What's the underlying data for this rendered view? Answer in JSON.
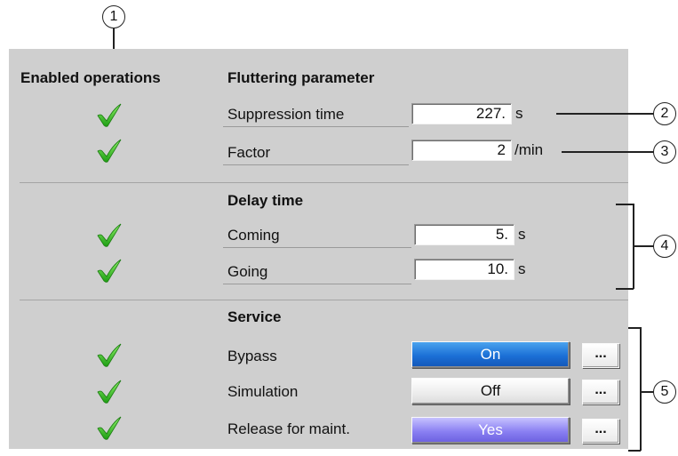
{
  "headers": {
    "enabled_operations": "Enabled operations",
    "fluttering_parameter": "Fluttering parameter",
    "delay_time": "Delay time",
    "service": "Service"
  },
  "fluttering": {
    "suppression_time": {
      "label": "Suppression time",
      "value": "227.",
      "unit": "s"
    },
    "factor": {
      "label": "Factor",
      "value": "2",
      "unit": "/min"
    }
  },
  "delay": {
    "coming": {
      "label": "Coming",
      "value": "5.",
      "unit": "s"
    },
    "going": {
      "label": "Going",
      "value": "10.",
      "unit": "s"
    }
  },
  "service": {
    "bypass": {
      "label": "Bypass",
      "state": "On"
    },
    "simulation": {
      "label": "Simulation",
      "state": "Off"
    },
    "release": {
      "label": "Release for maint.",
      "state": "Yes"
    },
    "more_label": "..."
  },
  "callouts": [
    "1",
    "2",
    "3",
    "4",
    "5"
  ],
  "colors": {
    "panel": "#cfcfcf",
    "check": "#3cc21e",
    "on": "#1b6fd6",
    "yes": "#7a6ff0"
  },
  "icons": {
    "check": "checkmark-icon"
  }
}
